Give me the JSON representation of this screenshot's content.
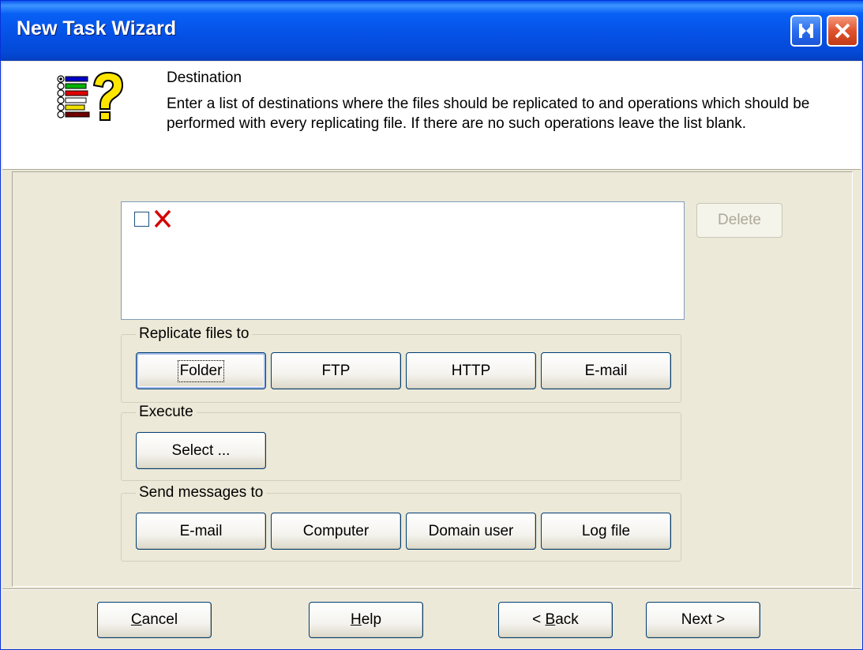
{
  "window": {
    "title": "New Task Wizard",
    "restore_icon": "restore-icon",
    "close_icon": "close-icon"
  },
  "header": {
    "icon": "task-list-question-icon",
    "title": "Destination",
    "description": "Enter a list of destinations where the files should be replicated to and operations which should be performed with every replicating file. If there are no such operations leave the list blank."
  },
  "list": {
    "items": [
      {
        "checked": false,
        "icon": "red-x-icon"
      }
    ]
  },
  "delete_button": "Delete",
  "replicate_group": {
    "label": "Replicate files to",
    "buttons": [
      "Folder",
      "FTP",
      "HTTP",
      "E-mail"
    ]
  },
  "execute_group": {
    "label": "Execute",
    "buttons": [
      "Select ..."
    ]
  },
  "messages_group": {
    "label": "Send messages to",
    "buttons": [
      "E-mail",
      "Computer",
      "Domain user",
      "Log file"
    ]
  },
  "footer": {
    "cancel": {
      "pre": "",
      "key": "C",
      "post": "ancel"
    },
    "help": {
      "pre": "",
      "key": "H",
      "post": "elp"
    },
    "back": {
      "pre": "< ",
      "key": "B",
      "post": "ack"
    },
    "next": "Next >"
  },
  "colors": {
    "titlebar": "#0550e4",
    "face": "#ece9d8",
    "border": "#003c74",
    "red_x": "#d40000"
  }
}
